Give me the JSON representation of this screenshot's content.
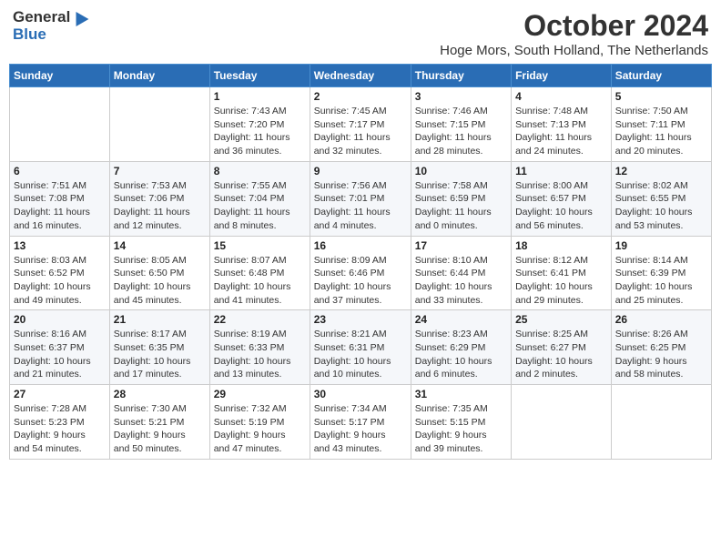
{
  "header": {
    "logo_general": "General",
    "logo_blue": "Blue",
    "month_title": "October 2024",
    "location": "Hoge Mors, South Holland, The Netherlands"
  },
  "weekdays": [
    "Sunday",
    "Monday",
    "Tuesday",
    "Wednesday",
    "Thursday",
    "Friday",
    "Saturday"
  ],
  "weeks": [
    [
      {
        "day": "",
        "info": ""
      },
      {
        "day": "",
        "info": ""
      },
      {
        "day": "1",
        "info": "Sunrise: 7:43 AM\nSunset: 7:20 PM\nDaylight: 11 hours\nand 36 minutes."
      },
      {
        "day": "2",
        "info": "Sunrise: 7:45 AM\nSunset: 7:17 PM\nDaylight: 11 hours\nand 32 minutes."
      },
      {
        "day": "3",
        "info": "Sunrise: 7:46 AM\nSunset: 7:15 PM\nDaylight: 11 hours\nand 28 minutes."
      },
      {
        "day": "4",
        "info": "Sunrise: 7:48 AM\nSunset: 7:13 PM\nDaylight: 11 hours\nand 24 minutes."
      },
      {
        "day": "5",
        "info": "Sunrise: 7:50 AM\nSunset: 7:11 PM\nDaylight: 11 hours\nand 20 minutes."
      }
    ],
    [
      {
        "day": "6",
        "info": "Sunrise: 7:51 AM\nSunset: 7:08 PM\nDaylight: 11 hours\nand 16 minutes."
      },
      {
        "day": "7",
        "info": "Sunrise: 7:53 AM\nSunset: 7:06 PM\nDaylight: 11 hours\nand 12 minutes."
      },
      {
        "day": "8",
        "info": "Sunrise: 7:55 AM\nSunset: 7:04 PM\nDaylight: 11 hours\nand 8 minutes."
      },
      {
        "day": "9",
        "info": "Sunrise: 7:56 AM\nSunset: 7:01 PM\nDaylight: 11 hours\nand 4 minutes."
      },
      {
        "day": "10",
        "info": "Sunrise: 7:58 AM\nSunset: 6:59 PM\nDaylight: 11 hours\nand 0 minutes."
      },
      {
        "day": "11",
        "info": "Sunrise: 8:00 AM\nSunset: 6:57 PM\nDaylight: 10 hours\nand 56 minutes."
      },
      {
        "day": "12",
        "info": "Sunrise: 8:02 AM\nSunset: 6:55 PM\nDaylight: 10 hours\nand 53 minutes."
      }
    ],
    [
      {
        "day": "13",
        "info": "Sunrise: 8:03 AM\nSunset: 6:52 PM\nDaylight: 10 hours\nand 49 minutes."
      },
      {
        "day": "14",
        "info": "Sunrise: 8:05 AM\nSunset: 6:50 PM\nDaylight: 10 hours\nand 45 minutes."
      },
      {
        "day": "15",
        "info": "Sunrise: 8:07 AM\nSunset: 6:48 PM\nDaylight: 10 hours\nand 41 minutes."
      },
      {
        "day": "16",
        "info": "Sunrise: 8:09 AM\nSunset: 6:46 PM\nDaylight: 10 hours\nand 37 minutes."
      },
      {
        "day": "17",
        "info": "Sunrise: 8:10 AM\nSunset: 6:44 PM\nDaylight: 10 hours\nand 33 minutes."
      },
      {
        "day": "18",
        "info": "Sunrise: 8:12 AM\nSunset: 6:41 PM\nDaylight: 10 hours\nand 29 minutes."
      },
      {
        "day": "19",
        "info": "Sunrise: 8:14 AM\nSunset: 6:39 PM\nDaylight: 10 hours\nand 25 minutes."
      }
    ],
    [
      {
        "day": "20",
        "info": "Sunrise: 8:16 AM\nSunset: 6:37 PM\nDaylight: 10 hours\nand 21 minutes."
      },
      {
        "day": "21",
        "info": "Sunrise: 8:17 AM\nSunset: 6:35 PM\nDaylight: 10 hours\nand 17 minutes."
      },
      {
        "day": "22",
        "info": "Sunrise: 8:19 AM\nSunset: 6:33 PM\nDaylight: 10 hours\nand 13 minutes."
      },
      {
        "day": "23",
        "info": "Sunrise: 8:21 AM\nSunset: 6:31 PM\nDaylight: 10 hours\nand 10 minutes."
      },
      {
        "day": "24",
        "info": "Sunrise: 8:23 AM\nSunset: 6:29 PM\nDaylight: 10 hours\nand 6 minutes."
      },
      {
        "day": "25",
        "info": "Sunrise: 8:25 AM\nSunset: 6:27 PM\nDaylight: 10 hours\nand 2 minutes."
      },
      {
        "day": "26",
        "info": "Sunrise: 8:26 AM\nSunset: 6:25 PM\nDaylight: 9 hours\nand 58 minutes."
      }
    ],
    [
      {
        "day": "27",
        "info": "Sunrise: 7:28 AM\nSunset: 5:23 PM\nDaylight: 9 hours\nand 54 minutes."
      },
      {
        "day": "28",
        "info": "Sunrise: 7:30 AM\nSunset: 5:21 PM\nDaylight: 9 hours\nand 50 minutes."
      },
      {
        "day": "29",
        "info": "Sunrise: 7:32 AM\nSunset: 5:19 PM\nDaylight: 9 hours\nand 47 minutes."
      },
      {
        "day": "30",
        "info": "Sunrise: 7:34 AM\nSunset: 5:17 PM\nDaylight: 9 hours\nand 43 minutes."
      },
      {
        "day": "31",
        "info": "Sunrise: 7:35 AM\nSunset: 5:15 PM\nDaylight: 9 hours\nand 39 minutes."
      },
      {
        "day": "",
        "info": ""
      },
      {
        "day": "",
        "info": ""
      }
    ]
  ]
}
